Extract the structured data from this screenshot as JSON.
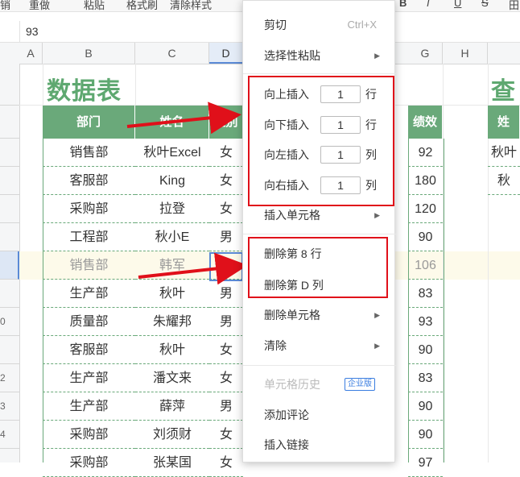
{
  "toolbar": {
    "items": [
      "销",
      "重做",
      "粘贴",
      "格式刷",
      "清除样式",
      "B",
      "I",
      "U",
      "S",
      "田"
    ]
  },
  "formula_bar": {
    "value": "93"
  },
  "column_headers": [
    "A",
    "B",
    "C",
    "D",
    "G",
    "H"
  ],
  "row_headers": [
    "",
    "",
    "",
    "",
    "",
    "",
    "",
    "",
    "0",
    "",
    "2",
    "3",
    "4"
  ],
  "sheet": {
    "title": "数据表",
    "title2": "查",
    "headers": {
      "dept": "部门",
      "name": "姓名",
      "gender": "性别",
      "perf": "绩效"
    },
    "right_header": "姓",
    "right_cells": [
      "秋叶",
      "秋"
    ],
    "rows": [
      {
        "dept": "销售部",
        "name": "秋叶Excel",
        "gender": "女",
        "perf": "92"
      },
      {
        "dept": "客服部",
        "name": "King",
        "gender": "女",
        "perf": "180"
      },
      {
        "dept": "采购部",
        "name": "拉登",
        "gender": "女",
        "perf": "120"
      },
      {
        "dept": "工程部",
        "name": "秋小E",
        "gender": "男",
        "perf": "90"
      },
      {
        "dept": "销售部",
        "name": "韩军",
        "gender": "男",
        "perf": "106"
      },
      {
        "dept": "生产部",
        "name": "秋叶",
        "gender": "男",
        "perf": "83"
      },
      {
        "dept": "质量部",
        "name": "朱耀邦",
        "gender": "男",
        "perf": "93"
      },
      {
        "dept": "客服部",
        "name": "秋叶",
        "gender": "女",
        "perf": "90"
      },
      {
        "dept": "生产部",
        "name": "潘文来",
        "gender": "女",
        "perf": "83"
      },
      {
        "dept": "生产部",
        "name": "薛萍",
        "gender": "男",
        "perf": "90"
      },
      {
        "dept": "采购部",
        "name": "刘须财",
        "gender": "女",
        "perf": "90"
      },
      {
        "dept": "采购部",
        "name": "张某国",
        "gender": "女",
        "perf": "97"
      }
    ]
  },
  "menu": {
    "cut": "剪切",
    "cut_shortcut": "Ctrl+X",
    "paste_special": "选择性粘贴",
    "insert_above": "向上插入",
    "insert_below": "向下插入",
    "insert_left": "向左插入",
    "insert_right": "向右插入",
    "count": "1",
    "unit_row": "行",
    "unit_col": "列",
    "insert_cells": "插入单元格",
    "delete_row": "删除第 8 行",
    "delete_col": "删除第 D 列",
    "delete_cells": "删除单元格",
    "clear": "清除",
    "cell_history": "单元格历史",
    "enterprise_badge": "企业版",
    "add_comment": "添加评论",
    "insert_link": "插入链接"
  },
  "colors": {
    "accent_green": "#6aa97a",
    "title_green": "#5ea870",
    "highlight_red": "#e0101a",
    "selection_blue": "#5a8ad6"
  }
}
